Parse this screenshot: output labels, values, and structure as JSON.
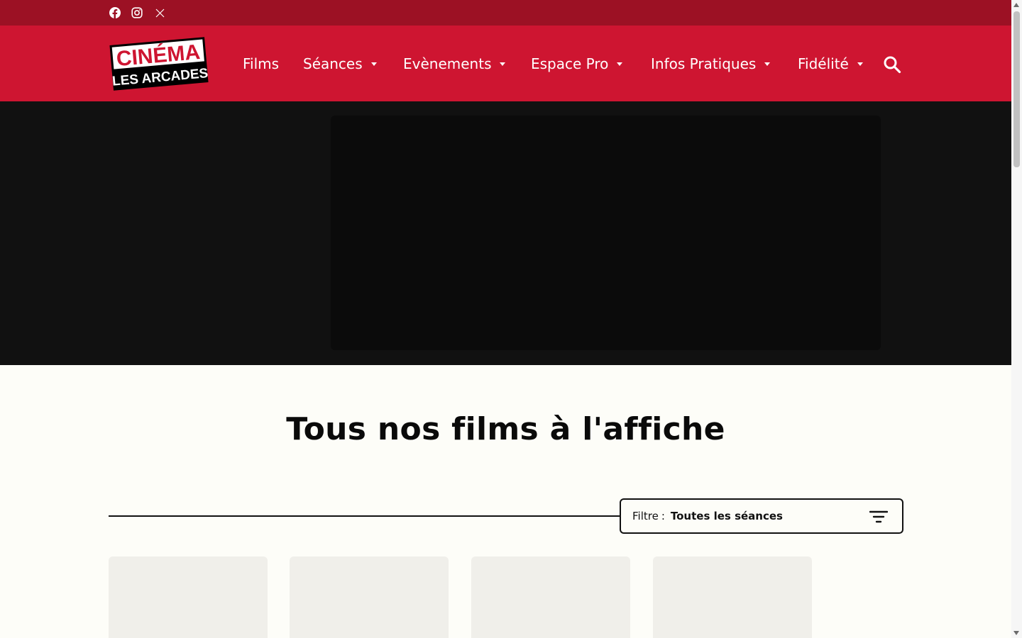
{
  "colors": {
    "topbar": "#9c1124",
    "header": "#ce1531",
    "hero": "#111111",
    "page": "#fdfdf8",
    "card": "#f0efea"
  },
  "social": [
    {
      "icon": "facebook-icon"
    },
    {
      "icon": "instagram-icon"
    },
    {
      "icon": "x-twitter-icon"
    }
  ],
  "logo": {
    "line1": "CINÉMA",
    "line2": "LES ARCADES"
  },
  "nav": {
    "items": [
      {
        "label": "Films",
        "dropdown": false
      },
      {
        "label": "Séances",
        "dropdown": true
      },
      {
        "label": "Evènements",
        "dropdown": true
      },
      {
        "label": "Espace Pro",
        "dropdown": true
      },
      {
        "label": "Infos Pratiques",
        "dropdown": true
      },
      {
        "label": "Fidélité",
        "dropdown": true
      }
    ],
    "search_icon": "search-icon"
  },
  "main": {
    "title": "Tous nos films à l'affiche",
    "filter": {
      "label": "Filtre",
      "separator": ":",
      "value": "Toutes les séances",
      "icon": "filter-icon"
    }
  }
}
